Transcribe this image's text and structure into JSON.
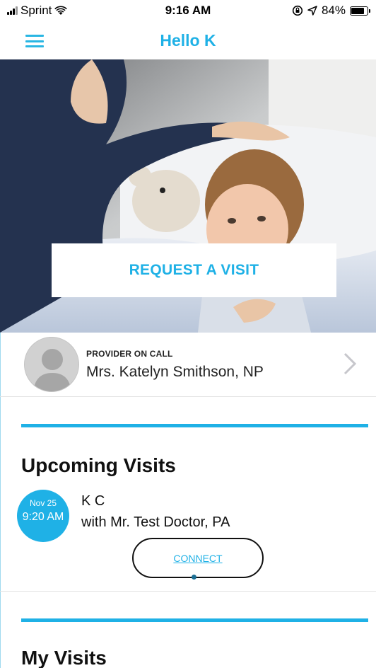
{
  "status_bar": {
    "carrier": "Sprint",
    "time": "9:16 AM",
    "battery_percent": "84%",
    "battery_level": 0.84,
    "icons": [
      "signal-bars-icon",
      "wifi-icon",
      "rotation-lock-icon",
      "location-arrow-icon",
      "battery-icon"
    ]
  },
  "nav": {
    "title": "Hello K",
    "menu_icon": "hamburger-menu-icon"
  },
  "hero": {
    "request_button_label": "REQUEST A VISIT"
  },
  "provider": {
    "tag": "PROVIDER ON CALL",
    "name": "Mrs. Katelyn Smithson, NP",
    "avatar_icon": "person-avatar-icon",
    "chevron_icon": "chevron-right-icon"
  },
  "upcoming": {
    "heading": "Upcoming Visits",
    "visit": {
      "date": "Nov 25",
      "time": "9:20 AM",
      "patient": "K C",
      "with": "with Mr. Test Doctor, PA",
      "connect_label": "CONNECT"
    }
  },
  "my_visits": {
    "heading": "My Visits"
  },
  "colors": {
    "accent": "#1fb1e6",
    "text": "#111111",
    "divider": "#e3e3e3"
  }
}
